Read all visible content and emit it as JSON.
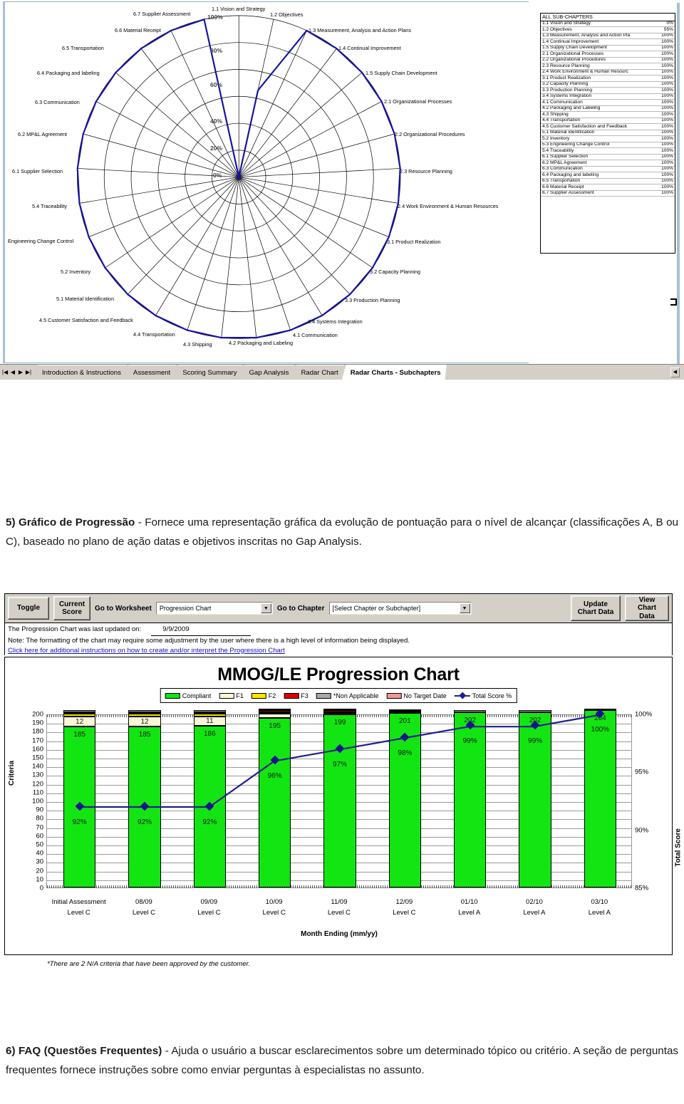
{
  "radar_worksheet": {
    "axis_ticks": [
      "0%",
      "20%",
      "40%",
      "60%",
      "80%",
      "100%"
    ],
    "spoke_labels": [
      "1.1 Vision and Strategy",
      "1.2 Objectives",
      "1.3 Measurement, Analysis and Action Plans",
      "1.4 Continual Improvement",
      "1.5 Supply Chain Development",
      "2.1 Organizational Processes",
      "2.2 Organizational Procedures",
      "2.3 Resource Planning",
      "2.4 Work Environment & Human Resources",
      "3.1 Product Realization",
      "3.2 Capacity Planning",
      "3.3 Production Planning",
      "3.4 Systems Integration",
      "4.1 Communication",
      "4.2 Packaging and Labeling",
      "4.3 Shipping",
      "4.4 Transportation",
      "4.5 Customer Satisfaction and Feedback",
      "5.1 Material Identification",
      "5.2 Inventory",
      "Engineering Change Control",
      "5.4 Traceability",
      "6.1 Supplier Selection",
      "6.2 MP&L Agreement",
      "6.3 Communication",
      "6.4 Packaging and labeling",
      "6.5 Transportation",
      "6.6 Material Receipt",
      "6.7 Supplier Assessment"
    ],
    "subchapter_panel": {
      "header": "ALL SUB-CHAPTERS",
      "rows": [
        {
          "name": "1.1 Vision and Strategy",
          "pct": "0%"
        },
        {
          "name": "1.2 Objectives",
          "pct": "55%"
        },
        {
          "name": "1.3 Measurement, Analysis and Action Pla",
          "pct": "100%"
        },
        {
          "name": "1.4 Continual Improvement",
          "pct": "100%"
        },
        {
          "name": "1.5 Supply Chain Development",
          "pct": "100%"
        },
        {
          "name": "2.1 Organizational Processes",
          "pct": "100%"
        },
        {
          "name": "2.2 Organizational Procedures",
          "pct": "100%"
        },
        {
          "name": "2.3 Resource Planning",
          "pct": "100%"
        },
        {
          "name": "2.4 Work Environment & Human Resourc",
          "pct": "100%"
        },
        {
          "name": "3.1 Product Realization",
          "pct": "100%"
        },
        {
          "name": "3.2 Capacity Planning",
          "pct": "100%"
        },
        {
          "name": "3.3 Production Planning",
          "pct": "100%"
        },
        {
          "name": "3.4 Systems Integration",
          "pct": "100%"
        },
        {
          "name": "4.1 Communication",
          "pct": "100%"
        },
        {
          "name": "4.2 Packaging and Labeling",
          "pct": "100%"
        },
        {
          "name": "4.3 Shipping",
          "pct": "100%"
        },
        {
          "name": "4.4 Transportation",
          "pct": "100%"
        },
        {
          "name": "4.5 Customer Satisfaction and Feedback",
          "pct": "100%"
        },
        {
          "name": "5.1 Material Identification",
          "pct": "100%"
        },
        {
          "name": "5.2 Inventory",
          "pct": "100%"
        },
        {
          "name": "5.3 Engineering Change Control",
          "pct": "100%"
        },
        {
          "name": "5.4 Traceability",
          "pct": "100%"
        },
        {
          "name": "6.1 Supplier Selection",
          "pct": "100%"
        },
        {
          "name": "6.2 MP&L Agreement",
          "pct": "100%"
        },
        {
          "name": "6.3 Communication",
          "pct": "100%"
        },
        {
          "name": "6.4 Packaging and labeling",
          "pct": "100%"
        },
        {
          "name": "6.5 Transportation",
          "pct": "100%"
        },
        {
          "name": "6.6 Material Receipt",
          "pct": "100%"
        },
        {
          "name": "6.7 Supplier Assessment",
          "pct": "100%"
        }
      ]
    },
    "sheet_tabs": [
      {
        "label": "Introduction & Instructions",
        "active": false
      },
      {
        "label": "Assessment",
        "active": false
      },
      {
        "label": "Scoring Summary",
        "active": false
      },
      {
        "label": "Gap Analysis",
        "active": false
      },
      {
        "label": "Radar Chart",
        "active": false
      },
      {
        "label": "Radar Charts - Subchapters",
        "active": true
      }
    ],
    "tab_nav": {
      "first": "|◀",
      "prev": "◀",
      "next": "▶",
      "last": "▶|"
    }
  },
  "text_blocks": {
    "item5_number": "5)",
    "item5_title": "Gráfico de Progressão",
    "item5_body": " - Fornece uma representação gráfica da evolução de pontuação para o nível de alcançar (classificações A, B ou C), baseado no plano de ação  datas e objetivos inscritas no  Gap Analysis.",
    "item6_number": "6)",
    "item6_title": "FAQ (Questões Frequentes)",
    "item6_body": "  - Ajuda o usuário a   buscar esclarecimentos sobre um determinado tópico ou critério. A seção de perguntas frequentes fornece instruções sobre como enviar perguntas à especialistas no assunto."
  },
  "progression_toolbar": {
    "toggle_label": "Toggle",
    "current_score_label": "Current\nScore",
    "goto_worksheet_label": "Go to Worksheet",
    "worksheet_value": "Progression Chart",
    "goto_chapter_label": "Go to Chapter",
    "chapter_value": "[Select Chapter or Subchapter]",
    "update_chart_label": "Update\nChart Data",
    "view_chart_label": "View\nChart Data",
    "dropdown_arrow": "▼"
  },
  "progression_info": {
    "updated_label": "The Progression Chart was last updated on:",
    "updated_date": "9/9/2009",
    "note": "Note:  The formatting of the chart may require some adjustment by the user where there is a high level of information being displayed.",
    "link": "Click here for additional instructions on how to create and/or interpret the Progression Chart",
    "footnote": "*There are 2 N/A criteria that have been approved by the customer."
  },
  "chart_data": {
    "type": "bar",
    "title": "MMOG/LE Progression Chart",
    "xlabel": "Month Ending (mm/yy)",
    "ylabel": "Criteria",
    "ylabel_right": "Total Score",
    "ylim": [
      0,
      200
    ],
    "yticks": [
      0,
      10,
      20,
      30,
      40,
      50,
      60,
      70,
      80,
      90,
      100,
      110,
      120,
      130,
      140,
      150,
      160,
      170,
      180,
      190,
      200
    ],
    "ylim_right": [
      85,
      100
    ],
    "yticks_right": [
      "85%",
      "90%",
      "95%",
      "100%"
    ],
    "grid": true,
    "legend_position": "top",
    "legend": [
      {
        "label": "Compliant",
        "color": "#13e513",
        "kind": "swatch"
      },
      {
        "label": "F1",
        "color": "#fbf6d8",
        "kind": "swatch"
      },
      {
        "label": "F2",
        "color": "#f5e500",
        "kind": "swatch"
      },
      {
        "label": "F3",
        "color": "#e00000",
        "kind": "swatch"
      },
      {
        "label": "*Non Applicable",
        "color": "#a9a9a9",
        "kind": "swatch"
      },
      {
        "label": "No Target Date",
        "color": "#f09999",
        "kind": "swatch"
      },
      {
        "label": "Total Score %",
        "color": "#1f1f8f",
        "kind": "line"
      }
    ],
    "categories": [
      "Initial Assessment",
      "08/09",
      "09/09",
      "10/09",
      "11/09",
      "12/09",
      "01/10",
      "02/10",
      "03/10"
    ],
    "category_levels": [
      "Level C",
      "Level C",
      "Level C",
      "Level C",
      "Level C",
      "Level C",
      "Level A",
      "Level A",
      "Level A"
    ],
    "series": [
      {
        "name": "Compliant",
        "color": "#13e513",
        "values": [
          185,
          185,
          186,
          195,
          199,
          201,
          202,
          202,
          204
        ]
      },
      {
        "name": "F1",
        "color": "#fbf6d8",
        "values": [
          12,
          12,
          11,
          5,
          2,
          0,
          0,
          0,
          0
        ]
      },
      {
        "name": "F2",
        "color": "#f5e500",
        "values": [
          3,
          3,
          3,
          2,
          1,
          1,
          0,
          0,
          0
        ]
      },
      {
        "name": "F3",
        "color": "#6b1010",
        "values": [
          2,
          2,
          2,
          2,
          2,
          1,
          0,
          0,
          0
        ]
      },
      {
        "name": "*Non Applicable",
        "color": "#a9a9a9",
        "values": [
          2,
          2,
          2,
          2,
          2,
          2,
          2,
          2,
          2
        ]
      }
    ],
    "bar_value_labels": [
      "185",
      "185",
      "186",
      "195",
      "199",
      "201",
      "202",
      "202",
      "204"
    ],
    "f1_value_labels": [
      "12",
      "12",
      "11",
      "",
      "",
      "",
      "",
      "",
      ""
    ],
    "total_score_line": {
      "name": "Total Score %",
      "color": "#1f1f8f",
      "values": [
        92,
        92,
        92,
        96,
        97,
        98,
        99,
        99,
        100
      ],
      "labels": [
        "92%",
        "92%",
        "92%",
        "96%",
        "97%",
        "98%",
        "99%",
        "99%",
        "100%"
      ]
    }
  }
}
